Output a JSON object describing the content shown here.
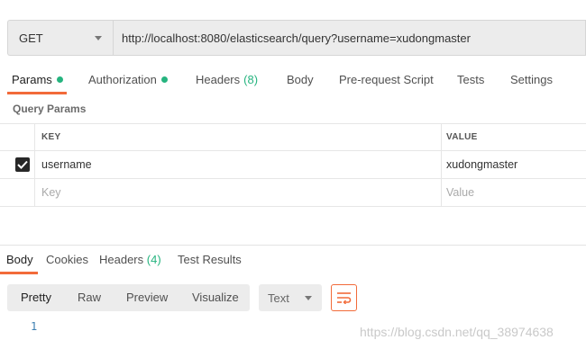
{
  "request": {
    "method": "GET",
    "url": "http://localhost:8080/elasticsearch/query?username=xudongmaster"
  },
  "request_tabs": [
    {
      "label": "Params",
      "indicator": "dot",
      "active": true
    },
    {
      "label": "Authorization",
      "indicator": "dot",
      "active": false
    },
    {
      "label": "Headers",
      "count": "(8)",
      "active": false
    },
    {
      "label": "Body",
      "active": false
    },
    {
      "label": "Pre-request Script",
      "active": false
    },
    {
      "label": "Tests",
      "active": false
    },
    {
      "label": "Settings",
      "active": false
    }
  ],
  "query_params": {
    "title": "Query Params",
    "headers": {
      "key": "KEY",
      "value": "VALUE"
    },
    "rows": [
      {
        "checked": true,
        "key": "username",
        "value": "xudongmaster"
      }
    ],
    "new_row": {
      "key_placeholder": "Key",
      "value_placeholder": "Value"
    }
  },
  "response_tabs": [
    {
      "label": "Body",
      "active": true
    },
    {
      "label": "Cookies",
      "active": false
    },
    {
      "label": "Headers",
      "count": "(4)",
      "active": false
    },
    {
      "label": "Test Results",
      "active": false
    }
  ],
  "response_view": {
    "modes": [
      "Pretty",
      "Raw",
      "Preview",
      "Visualize"
    ],
    "active_mode": "Pretty",
    "format": "Text",
    "wrap_icon": "wrap-lines-icon"
  },
  "body_lines": [
    "1"
  ],
  "watermark": "https://blog.csdn.net/qq_38974638",
  "colors": {
    "accent": "#f26b3a",
    "indicator_green": "#26b47f",
    "bar_background": "#ececec"
  }
}
